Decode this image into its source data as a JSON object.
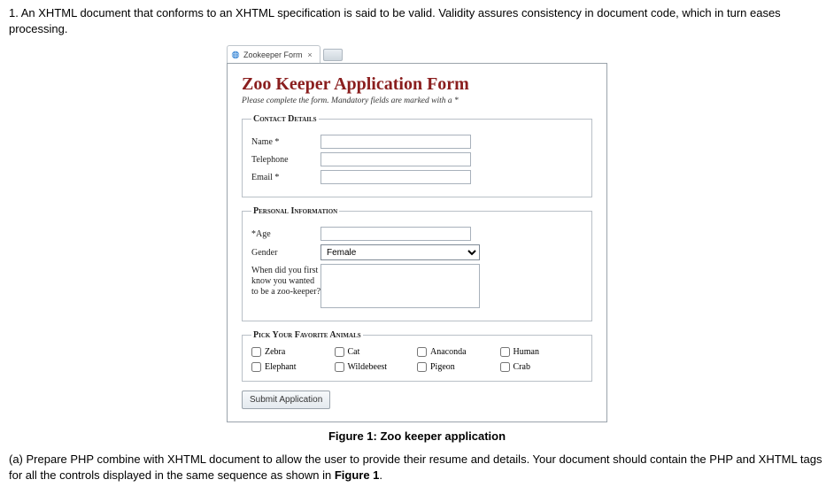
{
  "question": {
    "number": "1.",
    "text": "An XHTML document that conforms to an XHTML specification is said to be valid. Validity assures consistency in document code, which in turn eases processing."
  },
  "browser": {
    "tab_title": "Zookeeper Form"
  },
  "form": {
    "title": "Zoo Keeper Application Form",
    "subtitle": "Please complete the form. Mandatory fields are marked with a *",
    "sections": {
      "contact": {
        "legend": "Contact Details",
        "name_label": "Name *",
        "telephone_label": "Telephone",
        "email_label": "Email *"
      },
      "personal": {
        "legend": "Personal Information",
        "age_label": "*Age",
        "gender_label": "Gender",
        "gender_value": "Female",
        "story_label": "When did you first know you wanted to be a zoo-keeper?"
      },
      "animals": {
        "legend": "Pick Your Favorite Animals",
        "options": [
          "Zebra",
          "Cat",
          "Anaconda",
          "Human",
          "Elephant",
          "Wildebeest",
          "Pigeon",
          "Crab"
        ]
      }
    },
    "submit_label": "Submit Application"
  },
  "caption": "Figure 1: Zoo keeper application",
  "task": {
    "letter": "(a)",
    "text_before": "Prepare PHP combine with XHTML document to allow the user to provide their resume and details. Your document should contain the PHP and XHTML tags for all the controls displayed in the same sequence as shown in ",
    "bold": "Figure 1",
    "text_after": "."
  }
}
